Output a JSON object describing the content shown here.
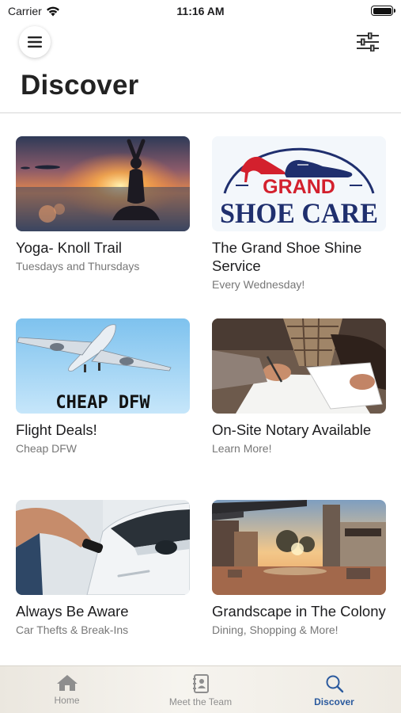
{
  "status_bar": {
    "carrier": "Carrier",
    "time": "11:16 AM"
  },
  "header": {
    "title": "Discover"
  },
  "cards": [
    {
      "title": "Yoga- Knoll Trail",
      "subtitle": "Tuesdays and Thursdays",
      "image": "yoga-sunset"
    },
    {
      "title": "The Grand Shoe Shine Service",
      "subtitle": "Every Wednesday!",
      "image": "grand-shoe-care-logo",
      "logo_top": "GRAND",
      "logo_bottom": "SHOE CARE"
    },
    {
      "title": "Flight Deals!",
      "subtitle": "Cheap DFW",
      "image": "airplane-sky",
      "image_text": "CHEAP DFW"
    },
    {
      "title": "On-Site Notary Available",
      "subtitle": "Learn More!",
      "image": "signing-documents"
    },
    {
      "title": "Always Be Aware",
      "subtitle": "Car Thefts & Break-Ins",
      "image": "car-key-fob"
    },
    {
      "title": "Grandscape in The Colony",
      "subtitle": "Dining, Shopping & More!",
      "image": "plaza-sunset"
    }
  ],
  "tab_bar": {
    "tabs": [
      {
        "label": "Home",
        "icon": "house-icon",
        "active": false
      },
      {
        "label": "Meet the Team",
        "icon": "contact-book-icon",
        "active": false
      },
      {
        "label": "Discover",
        "icon": "magnifier-icon",
        "active": true
      }
    ]
  },
  "colors": {
    "accent": "#2b5a9e",
    "logo_red": "#d3202d",
    "logo_navy": "#1f2f6e"
  }
}
